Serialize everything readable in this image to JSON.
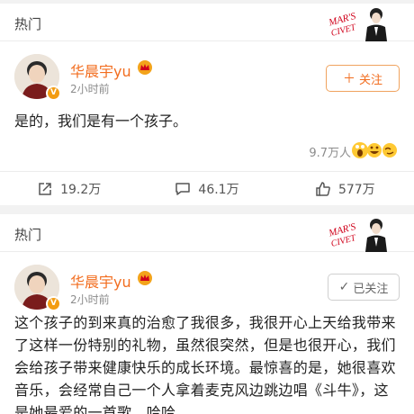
{
  "cards": [
    {
      "section_label": "热门",
      "user": {
        "name": "华晨宇yu",
        "time": "2小时前",
        "verified_badge": "V"
      },
      "follow_button": {
        "icon": "plus-icon",
        "label": "关注"
      },
      "text": "是的，我们是有一个孩子。",
      "reads": "9.7万人",
      "actions": {
        "repost": "19.2万",
        "comment": "46.1万",
        "like": "577万"
      }
    },
    {
      "section_label": "热门",
      "user": {
        "name": "华晨宇yu",
        "time": "2小时前",
        "verified_badge": "V"
      },
      "follow_button": {
        "icon": "check-icon",
        "label": "已关注"
      },
      "text": "这个孩子的到来真的治愈了我很多，我很开心上天给我带来了这样一份特别的礼物，虽然很突然，但是也很开心，我们会给孩子带来健康快乐的成长环境。最惊喜的是，她很喜欢音乐，会经常自己一个人拿着麦克风边跳边唱《斗牛》，这是她最爱的一首歌，哈哈"
    }
  ],
  "colors": {
    "accent": "#f26d1f",
    "background": "#f2f2f2",
    "badge": "#f39c12"
  }
}
